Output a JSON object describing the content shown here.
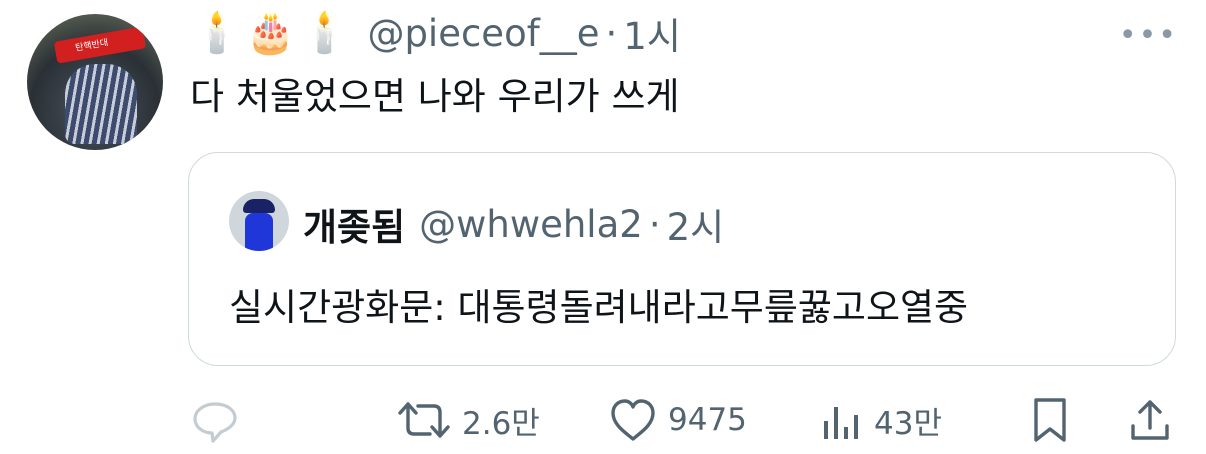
{
  "tweet": {
    "emojis": [
      "🕯️",
      "🎂",
      "🕯️"
    ],
    "handle": "@pieceof__e",
    "separator": "·",
    "time": "1시",
    "more_label": "•••",
    "text": "다 처울었으면 나와 우리가 쓰게"
  },
  "quote": {
    "name": "개좆됨",
    "handle": "@whwehla2",
    "separator": "·",
    "time": "2시",
    "text": "실시간광화문: 대통령돌려내라고무릎꿇고오열중"
  },
  "avatar_label": "탄핵반대",
  "actions": {
    "retweets": "2.6만",
    "likes": "9475",
    "views": "43만"
  },
  "colors": {
    "secondary_text": "#536471",
    "border": "#cfd9de",
    "primary_text": "#0f1419"
  }
}
